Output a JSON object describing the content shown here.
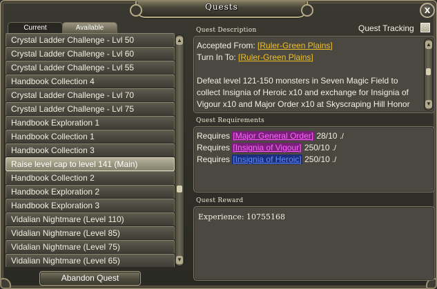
{
  "window": {
    "title": "Quests",
    "close_glyph": "x"
  },
  "tabs": [
    {
      "label": "Current"
    },
    {
      "label": "Available"
    }
  ],
  "quests": [
    "Crystal Ladder Challenge - Lvl 50",
    "Crystal Ladder Challenge - Lvl 60",
    "Crystal Ladder Challenge - Lvl 55",
    "Handbook Collection 4",
    "Crystal Ladder Challenge - Lvl 70",
    "Crystal Ladder Challenge - Lvl 75",
    "Handbook Exploration 1",
    "Handbook Collection 1",
    "Handbook Collection 3",
    "Raise level cap to level 141 (Main)",
    "Handbook Collection 2",
    "Handbook Exploration 2",
    "Handbook Exploration 3",
    "Vidalian Nightmare (Level 110)",
    "Vidalian Nightmare (Level 85)",
    "Vidalian Nightmare (Level 75)",
    "Vidalian Nightmare (Level 65)"
  ],
  "selected_quest": "Raise level cap to level 141 (Main)",
  "buttons": {
    "abandon": "Abandon Quest"
  },
  "tracking": {
    "label": "Quest Tracking",
    "checked": false
  },
  "description": {
    "section_label": "Quest Description",
    "accepted_from_label": "Accepted From:",
    "accepted_from": "[Ruler-Green Plains]",
    "turn_in_label": "Turn In To:",
    "turn_in": "[Ruler-Green Plains]",
    "body": "Defeat level 121-150 monsters in Seven Magic Field to collect Insignia of Heroic x10 and exchange for Insignia of Vigour x10 and Major Order x10 at Skyscraping Hill Honor"
  },
  "requirements": {
    "section_label": "Quest Requirements",
    "rows": [
      {
        "prefix": "Requires",
        "item": "[Major General Order]",
        "count": "28/10",
        "check": "./"
      },
      {
        "prefix": "Requires",
        "item": "[Insignia of Vigour]",
        "count": "250/10",
        "check": "./"
      },
      {
        "prefix": "Requires",
        "item": "[Insignia of Heroic]",
        "count": "250/10",
        "check": "./"
      }
    ]
  },
  "reward": {
    "section_label": "Quest Reward",
    "text": "Experience: 10755168"
  },
  "colors": {
    "link_gold": "#f0c020",
    "item_purple": "#ff66ff",
    "item_blue": "#5f8cff",
    "panel_bg": "#4a4840"
  }
}
